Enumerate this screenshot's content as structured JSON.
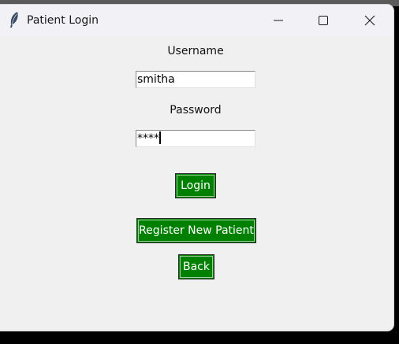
{
  "window": {
    "title": "Patient Login",
    "icon": "feather-icon",
    "controls": {
      "minimize_icon": "minimize-icon",
      "maximize_icon": "maximize-icon",
      "close_icon": "close-icon"
    }
  },
  "form": {
    "username_label": "Username",
    "username_value": "smitha",
    "password_label": "Password",
    "password_value": "****"
  },
  "buttons": {
    "login": "Login",
    "register": "Register New Patient",
    "back": "Back"
  },
  "colors": {
    "button_bg": "#008000",
    "button_text": "#ffffff",
    "window_bg": "#f0f0f0"
  }
}
